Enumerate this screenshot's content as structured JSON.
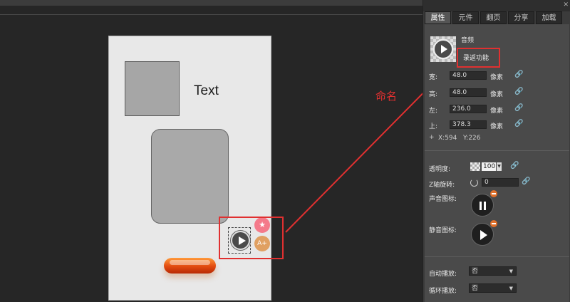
{
  "canvas": {
    "text_label": "Text",
    "badge_pink_glyph": "★",
    "badge_orange_glyph": "A+"
  },
  "annotation": {
    "label": "命名",
    "color": "#e03030"
  },
  "panel": {
    "tabs": [
      "属性",
      "元件",
      "翻页",
      "分享",
      "加载"
    ],
    "active_tab": 0,
    "type_label": "音频",
    "name_value": "录返功能",
    "width_label": "宽:",
    "width_value": "48.0",
    "height_label": "高:",
    "height_value": "48.0",
    "left_label": "左:",
    "left_value": "236.0",
    "top_label": "上:",
    "top_value": "378.3",
    "unit": "像素",
    "coord_x": "X:594",
    "coord_y": "Y:226",
    "opacity_label": "透明度:",
    "opacity_value": "100",
    "z_rotate_label": "Z轴旋转:",
    "z_rotate_value": "0",
    "sound_icon_label": "声音图标:",
    "mute_icon_label": "静音图标:",
    "autoplay_label": "自动播放:",
    "autoplay_value": "否",
    "loop_label": "循环播放:",
    "loop_value": "否"
  }
}
